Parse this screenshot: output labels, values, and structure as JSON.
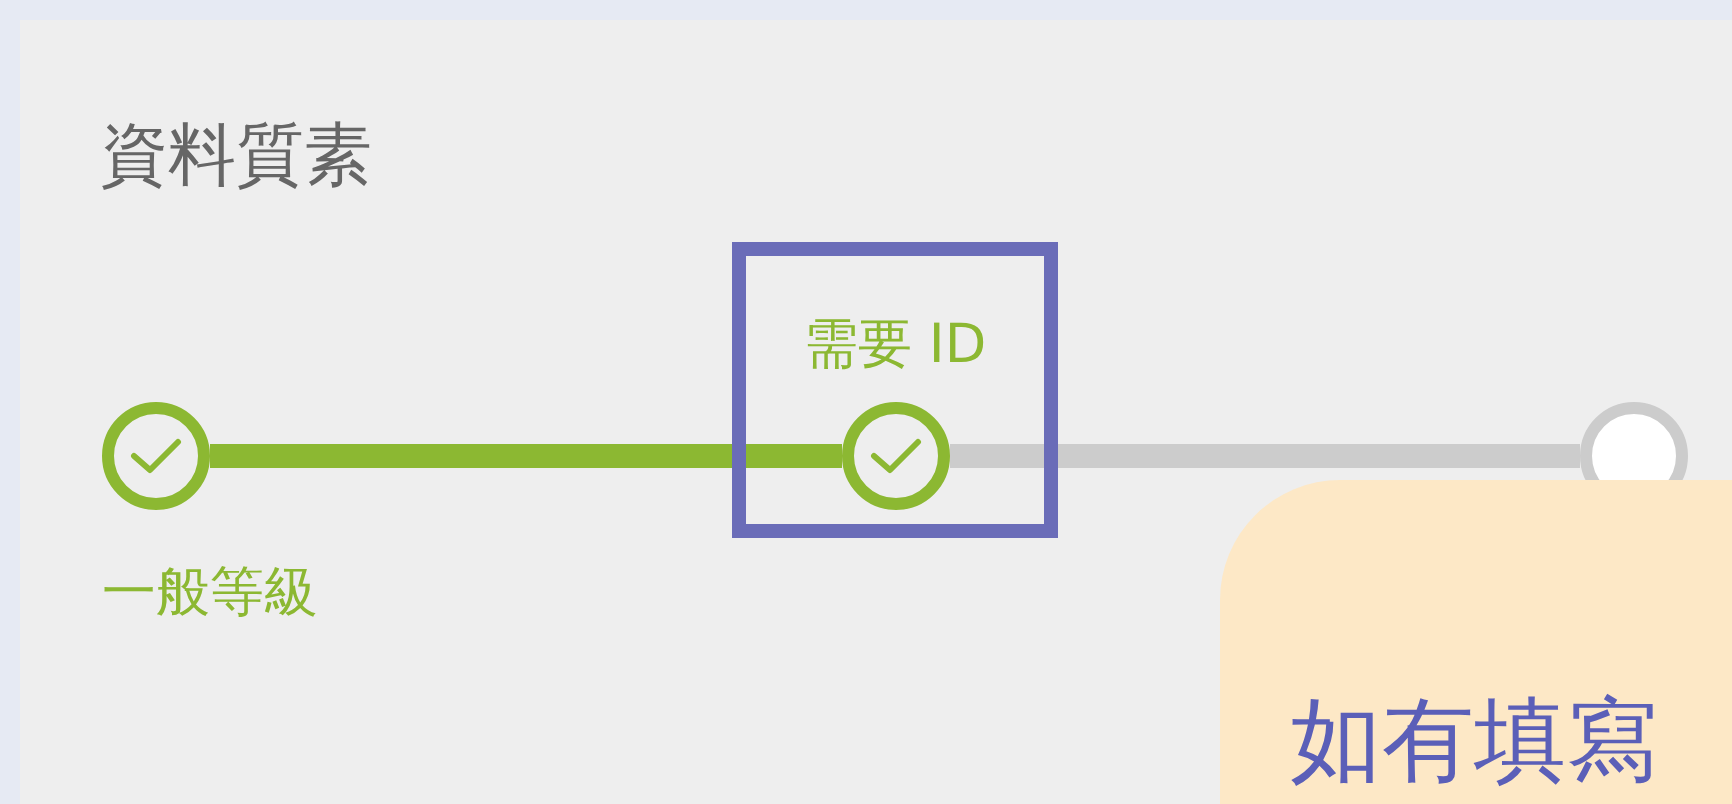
{
  "title": "資料質素",
  "steps": [
    {
      "label": "一般等級",
      "kind": "below",
      "done": true,
      "highlighted": false
    },
    {
      "label": "需要 ID",
      "kind": "above",
      "done": true,
      "highlighted": true
    },
    {
      "done": false,
      "highlighted": false
    }
  ],
  "annotation": {
    "callout": "如有填寫"
  }
}
